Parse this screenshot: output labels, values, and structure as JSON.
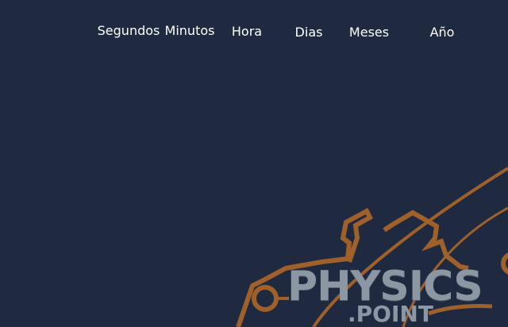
{
  "nav": {
    "items": [
      {
        "label": "Segundos"
      },
      {
        "label": "Minutos"
      },
      {
        "label": "Hora"
      },
      {
        "label": "Dias"
      },
      {
        "label": "Meses"
      },
      {
        "label": "Año"
      }
    ]
  },
  "logo": {
    "title": "PHYSICS",
    "subtitle": ".POINT",
    "accent_color": "#a0602a",
    "text_color": "#8d96a3"
  },
  "colors": {
    "background": "#1f2a40",
    "nav_text": "#ffffff"
  }
}
